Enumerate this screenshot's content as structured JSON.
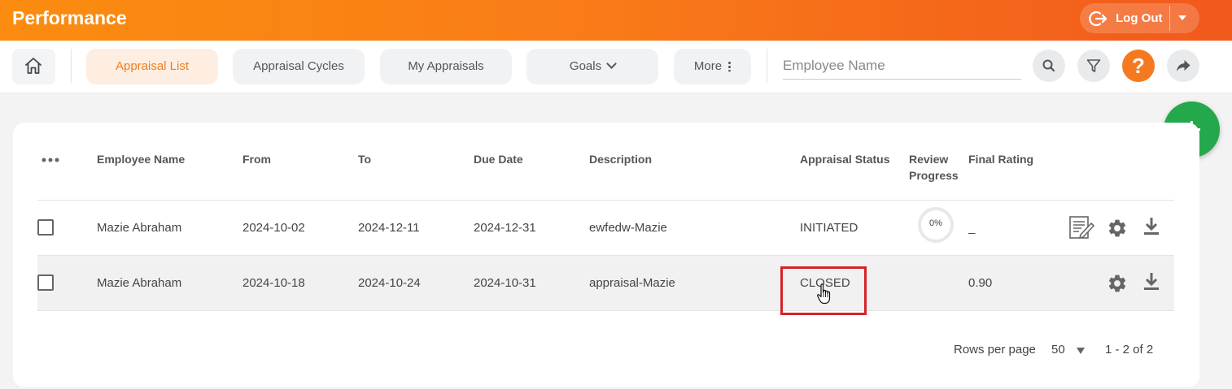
{
  "header": {
    "title": "Performance",
    "logout_label": "Log Out"
  },
  "nav": {
    "tabs": [
      {
        "label": "Appraisal List",
        "active": true
      },
      {
        "label": "Appraisal Cycles"
      },
      {
        "label": "My Appraisals"
      },
      {
        "label": "Goals"
      },
      {
        "label": "More"
      }
    ],
    "search_placeholder": "Employee Name",
    "help_label": "?"
  },
  "table": {
    "columns": {
      "employee_name": "Employee Name",
      "from": "From",
      "to": "To",
      "due_date": "Due Date",
      "description": "Description",
      "appraisal_status": "Appraisal Status",
      "review_progress_1": "Review",
      "review_progress_2": "Progress",
      "final_rating": "Final Rating"
    },
    "rows": [
      {
        "employee_name": "Mazie Abraham",
        "from": "2024-10-02",
        "to": "2024-12-11",
        "due_date": "2024-12-31",
        "description": "ewfedw-Mazie",
        "status": "INITIATED",
        "progress": "0%",
        "final_rating": "_"
      },
      {
        "employee_name": "Mazie Abraham",
        "from": "2024-10-18",
        "to": "2024-10-24",
        "due_date": "2024-10-31",
        "description": "appraisal-Mazie",
        "status": "CLOSED",
        "progress": "",
        "final_rating": "0.90"
      }
    ]
  },
  "pagination": {
    "rows_per_page_label": "Rows per page",
    "rows_per_page_value": "50",
    "range": "1 - 2 of 2"
  },
  "colors": {
    "header_gradient_start": "#fb8c0f",
    "header_gradient_end": "#f2591c",
    "active_tab_text": "#f07e24",
    "fab": "#23a84b",
    "highlight": "#d6222a"
  },
  "icons": [
    "home-icon",
    "logout-icon",
    "search-icon",
    "filter-icon",
    "help-icon",
    "share-icon",
    "add-icon",
    "more-icon",
    "edit-icon",
    "settings-icon",
    "download-icon"
  ]
}
